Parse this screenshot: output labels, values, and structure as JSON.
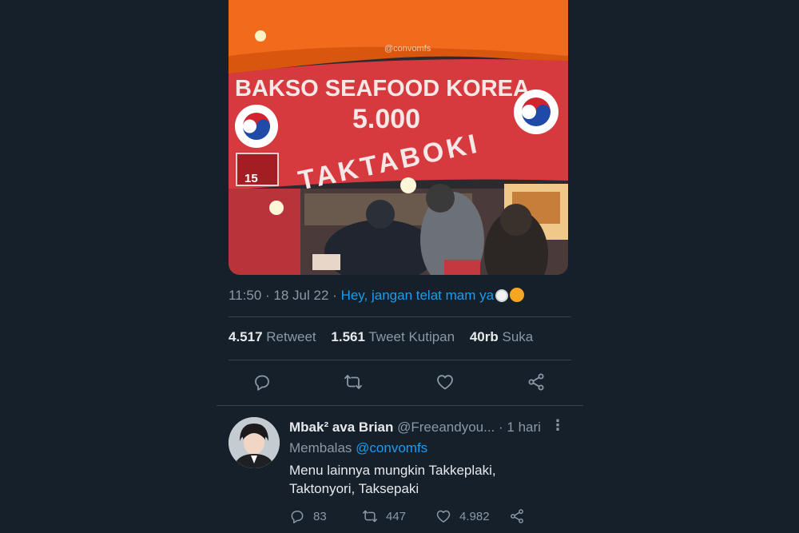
{
  "photo": {
    "watermark": "@convomfs",
    "banner_line1": "BAKSO SEAFOOD KOREA",
    "banner_price": "5.000",
    "banner_taktaboki": "TAKTABOKI",
    "stall_number": "15"
  },
  "tweet": {
    "time": "11:50",
    "date": "18 Jul 22",
    "separator": "·",
    "source": "Hey, jangan telat mam ya",
    "emoji_icons": [
      "plate-icon",
      "angry-face-icon"
    ]
  },
  "stats": {
    "retweets_count": "4.517",
    "retweets_label": "Retweet",
    "quotes_count": "1.561",
    "quotes_label": "Tweet Kutipan",
    "likes_count": "40rb",
    "likes_label": "Suka"
  },
  "actions": [
    "reply-icon",
    "retweet-icon",
    "like-icon",
    "share-icon"
  ],
  "reply": {
    "name": "Mbak² ava Brian",
    "handle": "@Freeandyou...",
    "time": "· 1 hari",
    "more": "⋮",
    "replying_label": "Membalas",
    "replying_to": "@convomfs",
    "text_line1": "Menu lainnya mungkin Takkeplaki,",
    "text_line2": "Taktonyori, Taksepaki",
    "reply_count": "83",
    "retweet_count": "447",
    "like_count": "4.982"
  },
  "colors": {
    "background": "#15202b",
    "accent": "#1d9bf0",
    "muted": "#8b98a5",
    "divider": "#38444d"
  }
}
